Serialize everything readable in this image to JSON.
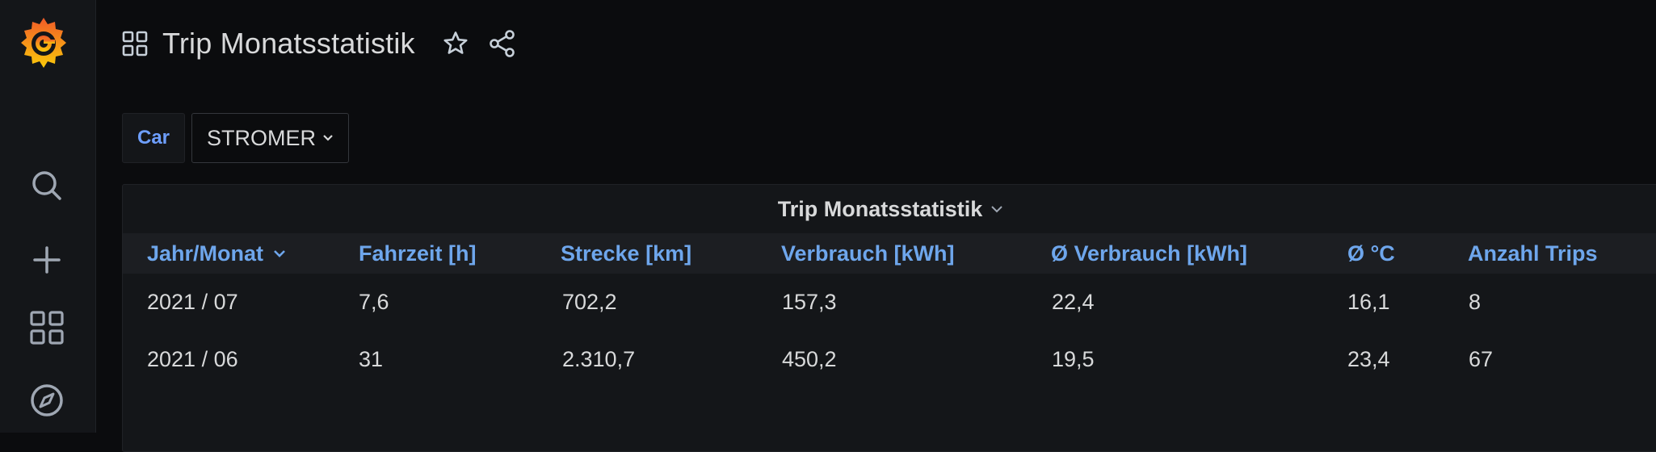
{
  "dashboard": {
    "title": "Trip Monatsstatistik"
  },
  "sidebar": {
    "items": [
      {
        "icon": "grafana-logo-icon"
      },
      {
        "icon": "search-icon"
      },
      {
        "icon": "plus-icon"
      },
      {
        "icon": "dashboards-icon"
      },
      {
        "icon": "explore-compass-icon"
      }
    ]
  },
  "variables": {
    "label": "Car",
    "selected": "STROMER"
  },
  "panel": {
    "title": "Trip Monatsstatistik",
    "columns": [
      "Jahr/Monat",
      "Fahrzeit [h]",
      "Strecke [km]",
      "Verbrauch [kWh]",
      "Ø Verbrauch [kWh]",
      "Ø °C",
      "Anzahl Trips"
    ],
    "rows": [
      [
        "2021 / 07",
        "7,6",
        "702,2",
        "157,3",
        "22,4",
        "16,1",
        "8"
      ],
      [
        "2021 / 06",
        "31",
        "2.310,7",
        "450,2",
        "19,5",
        "23,4",
        "67"
      ]
    ]
  },
  "colors": {
    "accent": "#6ea6ec",
    "background": "#0b0c0e",
    "panel": "#141619",
    "logo_orange": "#f46800",
    "logo_yellow": "#fbca0a"
  }
}
